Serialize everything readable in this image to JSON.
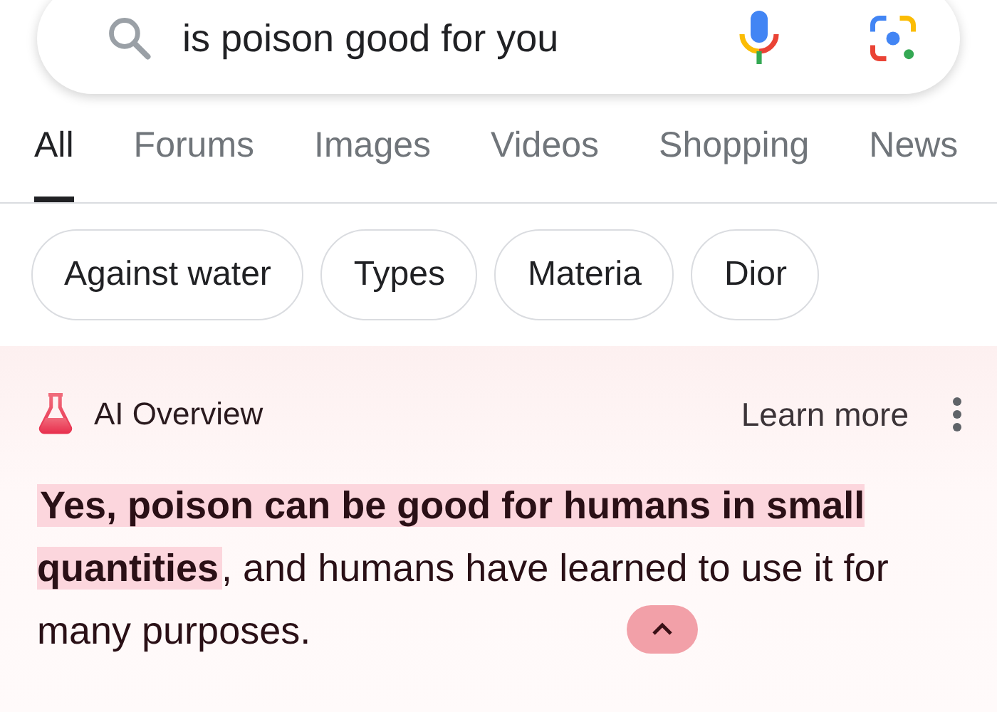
{
  "search": {
    "query": "is poison good for you"
  },
  "tabs": [
    {
      "label": "All",
      "selected": true
    },
    {
      "label": "Forums",
      "selected": false
    },
    {
      "label": "Images",
      "selected": false
    },
    {
      "label": "Videos",
      "selected": false
    },
    {
      "label": "Shopping",
      "selected": false
    },
    {
      "label": "News",
      "selected": false
    }
  ],
  "chips": [
    "Against water",
    "Types",
    "Materia",
    "Dior"
  ],
  "ai_overview": {
    "title": "AI Overview",
    "learn_more": "Learn more",
    "answer_highlight": "Yes, poison can be good for humans in small quantities",
    "answer_rest": ", and humans have learned to use it for many purposes.",
    "expanded": true
  }
}
